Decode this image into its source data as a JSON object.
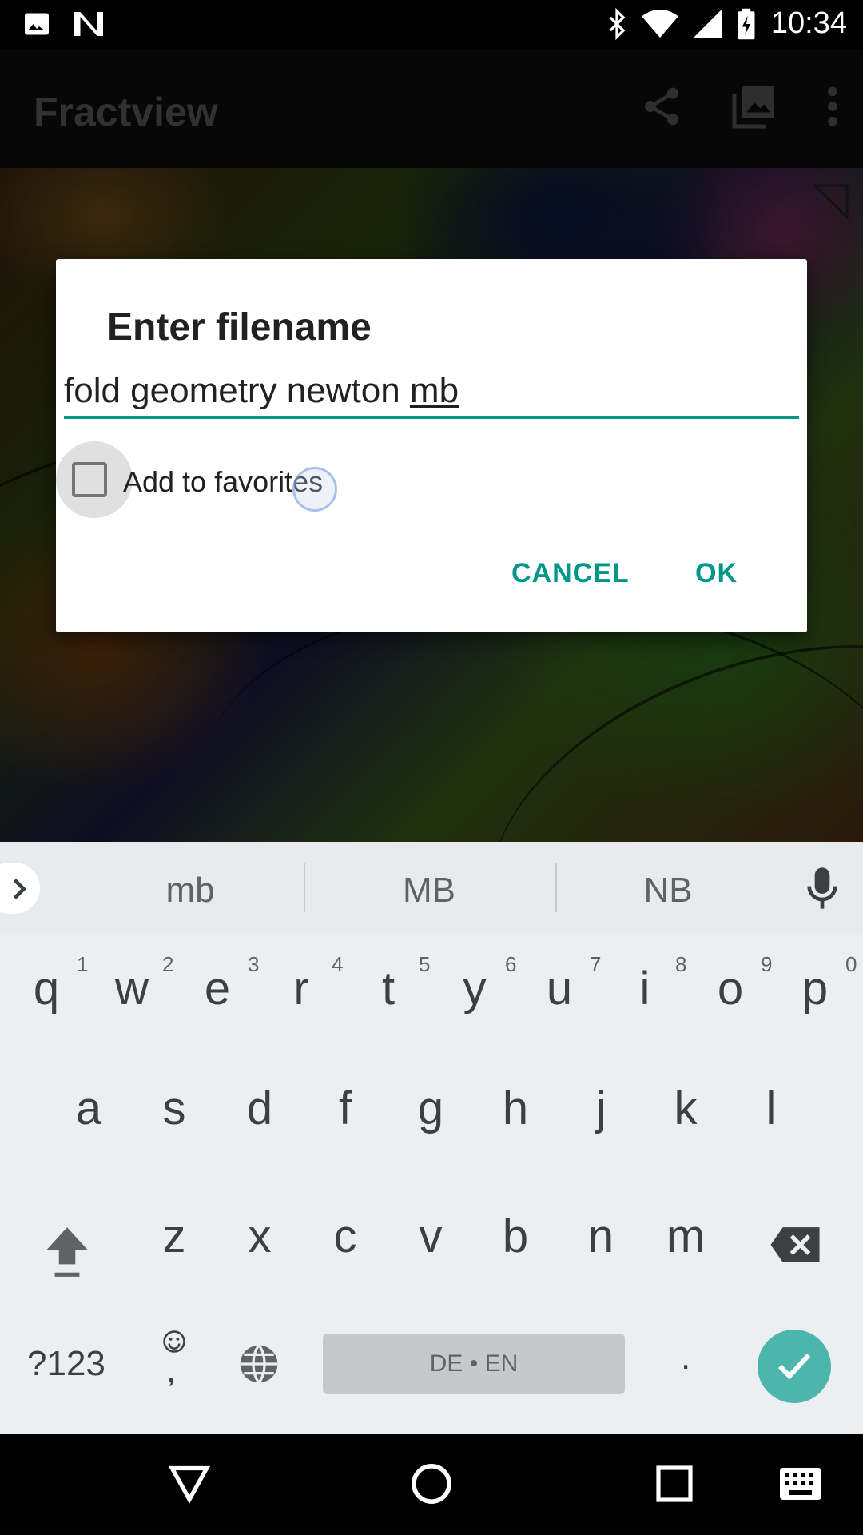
{
  "status_bar": {
    "time": "10:34",
    "left_icons": [
      "image-icon",
      "n-notification-icon"
    ],
    "right_icons": [
      "bluetooth-icon",
      "wifi-icon",
      "signal-icon",
      "battery-charging-icon"
    ]
  },
  "app_bar": {
    "title": "Fractview",
    "actions": [
      "share-icon",
      "gallery-icon",
      "overflow-menu-icon"
    ]
  },
  "dialog": {
    "title": "Enter filename",
    "input_text": "fold geometry newton ",
    "input_composing": "mb",
    "checkbox_label": "Add to favorites",
    "checkbox_checked": false,
    "cancel_label": "CANCEL",
    "ok_label": "OK",
    "accent_color": "#009688"
  },
  "keyboard": {
    "suggestions": [
      "mb",
      "MB",
      "NB"
    ],
    "row1": [
      "q",
      "w",
      "e",
      "r",
      "t",
      "y",
      "u",
      "i",
      "o",
      "p"
    ],
    "row1_numbers": [
      "1",
      "2",
      "3",
      "4",
      "5",
      "6",
      "7",
      "8",
      "9",
      "0"
    ],
    "row2": [
      "a",
      "s",
      "d",
      "f",
      "g",
      "h",
      "j",
      "k",
      "l"
    ],
    "row3": [
      "z",
      "x",
      "c",
      "v",
      "b",
      "n",
      "m"
    ],
    "symbols_label": "?123",
    "emoji_comma": ",",
    "period": ".",
    "space_label": "DE • EN",
    "enter_color": "#4db6ac"
  },
  "nav_bar": {
    "buttons": [
      "back-icon",
      "home-icon",
      "recents-icon",
      "keyboard-icon"
    ]
  }
}
